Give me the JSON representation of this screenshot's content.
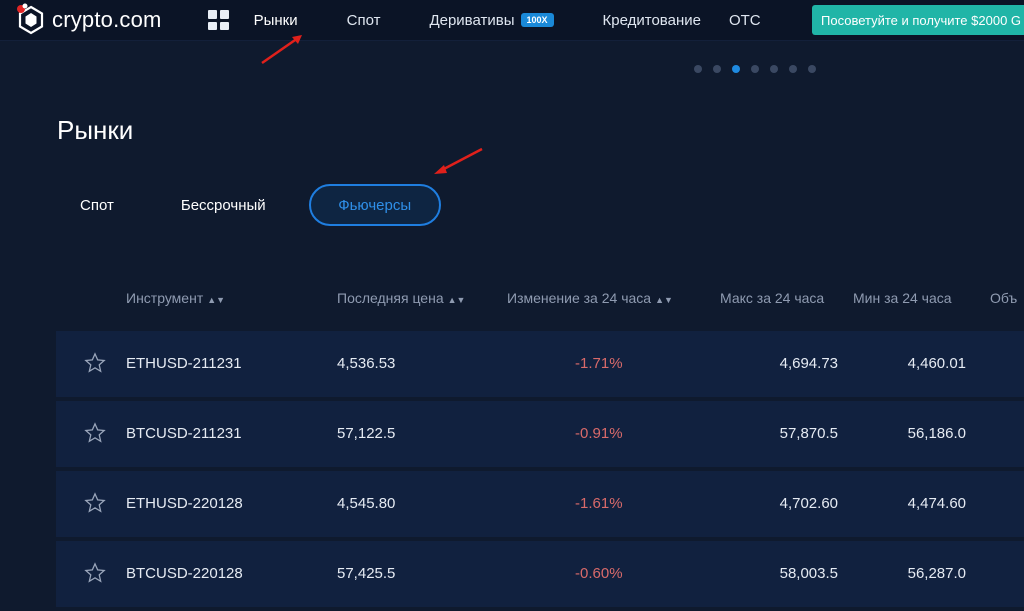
{
  "header": {
    "logo_text": "crypto.com",
    "nav": [
      {
        "label": "Рынки"
      },
      {
        "label": "Спот"
      },
      {
        "label": "Деривативы",
        "badge": "100X"
      },
      {
        "label": "Кредитование"
      },
      {
        "label": "OTC"
      }
    ],
    "cta": "Посоветуйте и получите $2000 G"
  },
  "carousel": {
    "total": 7,
    "active": 2
  },
  "page_title": "Рынки",
  "tabs": [
    {
      "label": "Спот"
    },
    {
      "label": "Бессрочный"
    },
    {
      "label": "Фьючерсы",
      "active": true
    }
  ],
  "table": {
    "columns": [
      "Инструмент",
      "Последняя цена",
      "Изменение за 24 часа",
      "Макс за 24 часа",
      "Мин за 24 часа",
      "Объ"
    ],
    "rows": [
      {
        "instrument": "ETHUSD-211231",
        "last": "4,536.53",
        "change": "-1.71%",
        "high": "4,694.73",
        "low": "4,460.01"
      },
      {
        "instrument": "BTCUSD-211231",
        "last": "57,122.5",
        "change": "-0.91%",
        "high": "57,870.5",
        "low": "56,186.0"
      },
      {
        "instrument": "ETHUSD-220128",
        "last": "4,545.80",
        "change": "-1.61%",
        "high": "4,702.60",
        "low": "4,474.60"
      },
      {
        "instrument": "BTCUSD-220128",
        "last": "57,425.5",
        "change": "-0.60%",
        "high": "58,003.5",
        "low": "56,287.0"
      }
    ]
  },
  "colors": {
    "background": "#0f1a2e",
    "topbar": "#0b1426",
    "accent": "#1f7ee0",
    "cta": "#20b5a7",
    "negative": "#d96a6a",
    "annotation_arrow": "#e0201b"
  },
  "icons": [
    "crypto-logo-icon",
    "apps-grid-icon",
    "star-icon",
    "sort-icon"
  ]
}
